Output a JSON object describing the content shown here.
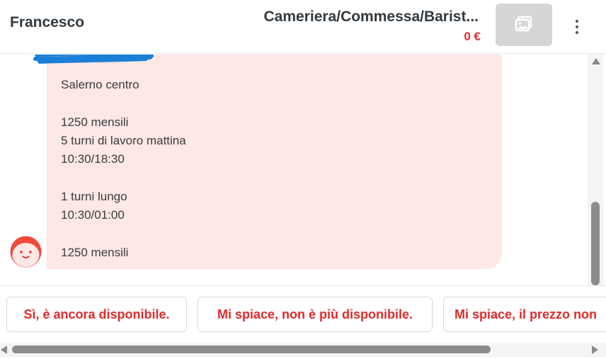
{
  "header": {
    "contact_name": "Francesco",
    "listing_title": "Cameriera/Commessa/Barist...",
    "listing_price": "0 €",
    "thumbnail_icon": "image-placeholder-icon",
    "more_icon": "more-vertical-icon"
  },
  "message": {
    "lines": [
      "Salerno centro",
      "",
      "1250 mensili",
      "5 turni di lavoro mattina",
      "10:30/18:30",
      "",
      "1 turni lungo",
      "10:30/01:00",
      "",
      "1250 mensili"
    ],
    "redaction_color": "#1a7fd6",
    "bubble_color": "#fde8e6"
  },
  "quick_replies": [
    "Sì, è ancora disponibile.",
    "Mi spiace, non è più disponibile.",
    "Mi spiace, il prezzo non"
  ],
  "colors": {
    "accent": "#e02b2b",
    "text": "#333a40"
  }
}
